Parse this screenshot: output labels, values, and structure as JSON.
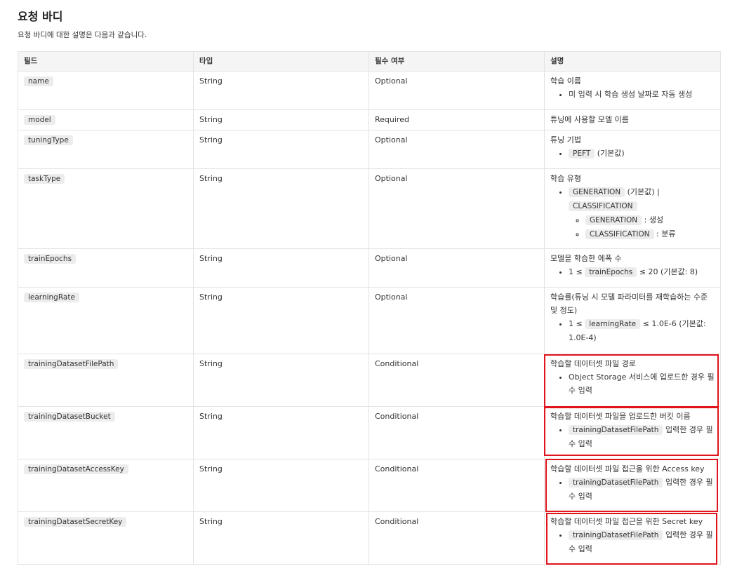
{
  "heading": "요청 바디",
  "intro": "요청 바디에 대한 설명은 다음과 같습니다.",
  "columns": [
    "필드",
    "타입",
    "필수 여부",
    "설명"
  ],
  "rows": [
    {
      "field": "name",
      "type": "String",
      "required": "Optional",
      "desc": "학습 이름",
      "b1": "미 입력 시 학습 생성 날짜로 자동 생성"
    },
    {
      "field": "model",
      "type": "String",
      "required": "Required",
      "desc": "튜닝에 사용할 모델 이름"
    },
    {
      "field": "tuningType",
      "type": "String",
      "required": "Optional",
      "desc": "튜닝 기법",
      "b1_code": "PEFT",
      "b1_after": "(기본값)"
    },
    {
      "field": "taskType",
      "type": "String",
      "required": "Optional",
      "desc": "학습 유형",
      "b1_code": "GENERATION",
      "b1_after": "(기본값) |",
      "b1_code2": "CLASSIFICATION",
      "s1_code": "GENERATION",
      "s1_after": ": 생성",
      "s2_code": "CLASSIFICATION",
      "s2_after": ": 분류"
    },
    {
      "field": "trainEpochs",
      "type": "String",
      "required": "Optional",
      "desc": "모델을 학습한 에폭 수",
      "b1_before": "1 ≤",
      "b1_code": "trainEpochs",
      "b1_after": "≤ 20 (기본값: 8)"
    },
    {
      "field": "learningRate",
      "type": "String",
      "required": "Optional",
      "desc": "학습률(튜닝 시 모델 파라미터를 재학습하는 수준 및 정도)",
      "b1_before": "1 ≤",
      "b1_code": "learningRate",
      "b1_after": "≤ 1.0E-6 (기본값: 1.0E-4)"
    },
    {
      "field": "trainingDatasetFilePath",
      "type": "String",
      "required": "Conditional",
      "desc": "학습할 데이터셋 파일 경로",
      "b1": "Object Storage 서비스에 업로드한 경우 필수 입력"
    },
    {
      "field": "trainingDatasetBucket",
      "type": "String",
      "required": "Conditional",
      "desc": "학습할 데이터셋 파일을 업로드한 버킷 이름",
      "b1_code": "trainingDatasetFilePath",
      "b1_after": "입력한 경우 필수 입력"
    },
    {
      "field": "trainingDatasetAccessKey",
      "type": "String",
      "required": "Conditional",
      "desc": "학습할 데이터셋 파일 접근을 위한 Access key",
      "b1_code": "trainingDatasetFilePath",
      "b1_after": "입력한 경우 필수 입력"
    },
    {
      "field": "trainingDatasetSecretKey",
      "type": "String",
      "required": "Conditional",
      "desc": "학습할 데이터셋 파일 접근을 위한 Secret key",
      "b1_code": "trainingDatasetFilePath",
      "b1_after": "입력한 경우 필수 입력"
    }
  ],
  "highlight_color": "#e0141c",
  "code_bg": "#ececec",
  "header_bg": "#f5f5f5"
}
